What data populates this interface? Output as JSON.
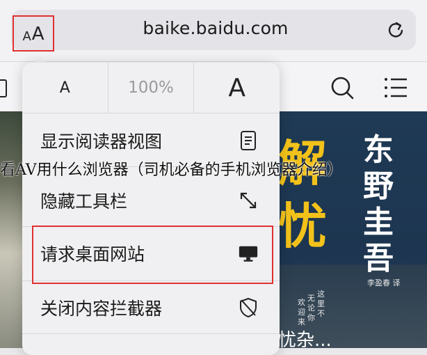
{
  "toolbar": {
    "aa_small": "A",
    "aa_big": "A",
    "url": "baike.baidu.com"
  },
  "zoom": {
    "decrease_label": "A",
    "level": "100%",
    "increase_label": "A"
  },
  "menu": {
    "items": [
      {
        "label": "显示阅读器视图",
        "icon": "reader-icon"
      },
      {
        "label": "隐藏工具栏",
        "icon": "expand-arrows-icon"
      },
      {
        "label": "请求桌面网站",
        "icon": "desktop-monitor-icon"
      },
      {
        "label": "关闭内容拦截器",
        "icon": "shield-off-icon"
      }
    ]
  },
  "cover": {
    "big1": "解",
    "big2": "忧",
    "author": "东野圭吾",
    "translator": "李盈春 译",
    "small_lines": [
      "欢迎来",
      "无论你",
      "这里不"
    ],
    "bottom_text": "忧杂..."
  },
  "caption": "看AV用什么浏览器（司机必备的手机浏览器介绍）",
  "colors": {
    "highlight": "#e03030",
    "popup_bg": "#f0f0f2",
    "cover_title": "#f3c21a"
  }
}
